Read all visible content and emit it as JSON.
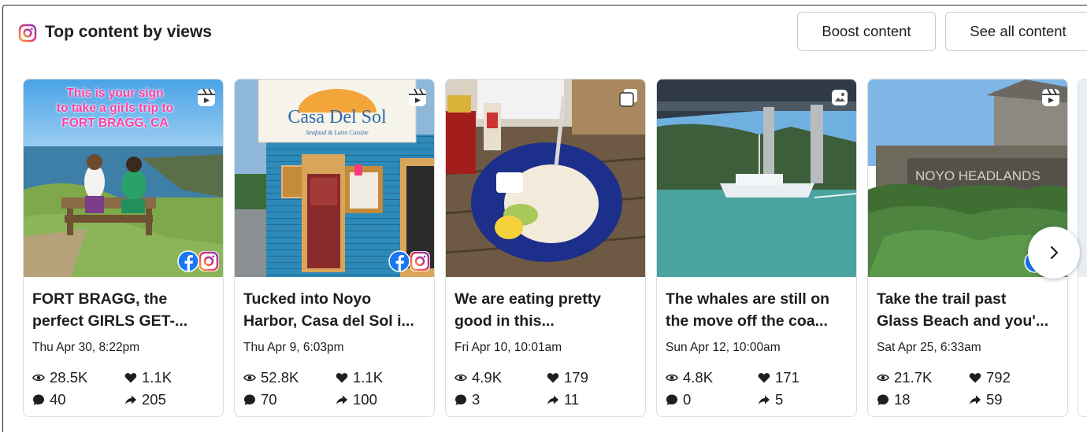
{
  "header": {
    "title": "Top content by views",
    "boost_label": "Boost content",
    "see_all_label": "See all content",
    "icon": "instagram-icon"
  },
  "colors": {
    "instagram_gradient": [
      "#f9a13a",
      "#e1306c",
      "#833ab4"
    ],
    "facebook_blue": "#1877f2",
    "border": "#dadde1"
  },
  "cards": [
    {
      "title_line1": "FORT BRAGG, the",
      "title_line2": "perfect GIRLS GET-...",
      "date": "Thu Apr 30, 8:22pm",
      "views": "28.5K",
      "likes": "1.1K",
      "comments": "40",
      "shares": "205",
      "overlay_text": [
        "This is your sign",
        "to take a girls trip to",
        "FORT BRAGG, CA"
      ],
      "post_type_icon": "reel-icon",
      "platforms": [
        "facebook",
        "instagram"
      ]
    },
    {
      "title_line1": "Tucked into Noyo",
      "title_line2": "Harbor, Casa del Sol i...",
      "date": "Thu Apr 9, 6:03pm",
      "views": "52.8K",
      "likes": "1.1K",
      "comments": "70",
      "shares": "100",
      "sign_title": "Casa Del Sol",
      "sign_sub": "Seafood & Latin Cuisine",
      "post_type_icon": "reel-icon",
      "platforms": [
        "facebook",
        "instagram"
      ]
    },
    {
      "title_line1": "We are eating pretty",
      "title_line2": "good in this...",
      "date": "Fri Apr 10, 10:01am",
      "views": "4.9K",
      "likes": "179",
      "comments": "3",
      "shares": "11",
      "post_type_icon": "carousel-icon",
      "platforms": []
    },
    {
      "title_line1": "The whales are still on",
      "title_line2": "the move off the coa...",
      "date": "Sun Apr 12, 10:00am",
      "views": "4.8K",
      "likes": "171",
      "comments": "0",
      "shares": "5",
      "post_type_icon": "photo-icon",
      "platforms": []
    },
    {
      "title_line1": "Take the trail past",
      "title_line2": "Glass Beach and you'...",
      "date": "Sat Apr 25, 6:33am",
      "views": "21.7K",
      "likes": "792",
      "comments": "18",
      "shares": "59",
      "sign_text": "NOYO HEADLANDS",
      "post_type_icon": "reel-icon",
      "platforms": [
        "facebook"
      ]
    }
  ]
}
